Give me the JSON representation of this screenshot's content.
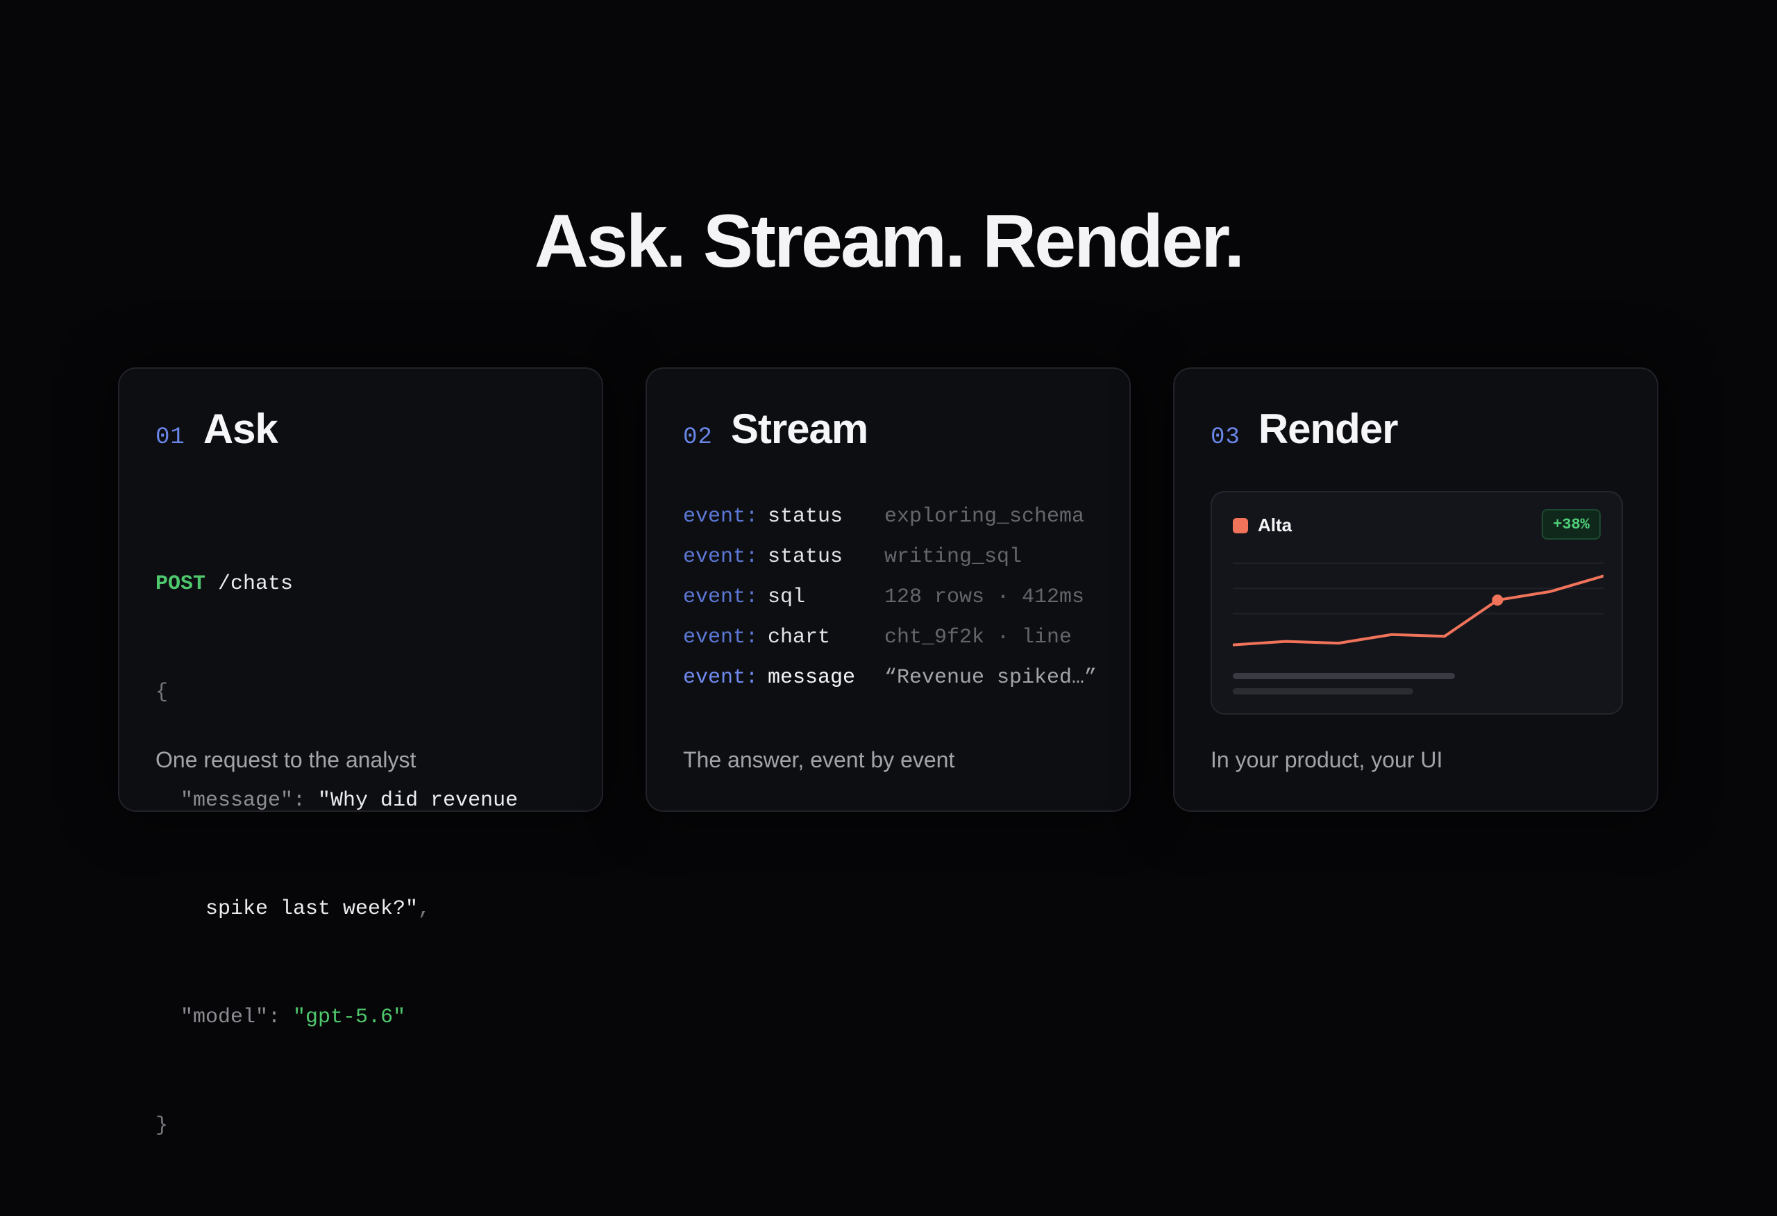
{
  "headline": "Ask. Stream. Render.",
  "cards": [
    {
      "number": "01",
      "title": "Ask",
      "caption": "One request to the analyst",
      "code": {
        "method": "POST",
        "path": " /chats",
        "open_brace": "{",
        "message_key": "  \"message\": ",
        "message_value_1": "\"Why did revenue",
        "message_value_2": "    spike last week?\"",
        "comma": ",",
        "model_key": "  \"model\": ",
        "model_value": "\"gpt-5.6\"",
        "close_brace": "}"
      }
    },
    {
      "number": "02",
      "title": "Stream",
      "caption": "The answer, event by event",
      "events": [
        {
          "label": "event:",
          "name": "status",
          "value": "exploring_schema"
        },
        {
          "label": "event:",
          "name": "status",
          "value": "writing_sql"
        },
        {
          "label": "event:",
          "name": "sql",
          "value": "128 rows · 412ms"
        },
        {
          "label": "event:",
          "name": "chart",
          "value": "cht_9f2k · line"
        },
        {
          "label": "event:",
          "name": "message",
          "value": "“Revenue spiked…”"
        }
      ]
    },
    {
      "number": "03",
      "title": "Render",
      "caption": "In your product, your UI",
      "widget": {
        "name": "Alta",
        "badge": "+38%",
        "accent_color": "#f0735a",
        "badge_color": "#4fd07a"
      }
    }
  ],
  "chart_data": {
    "type": "line",
    "title": "Alta",
    "x": [
      0,
      1,
      2,
      3,
      4,
      5,
      6,
      7
    ],
    "series": [
      {
        "values": [
          10,
          14,
          12,
          22,
          20,
          62,
          72,
          90
        ]
      }
    ],
    "highlight_index": 5,
    "ylim": [
      0,
      100
    ],
    "grid": true
  }
}
